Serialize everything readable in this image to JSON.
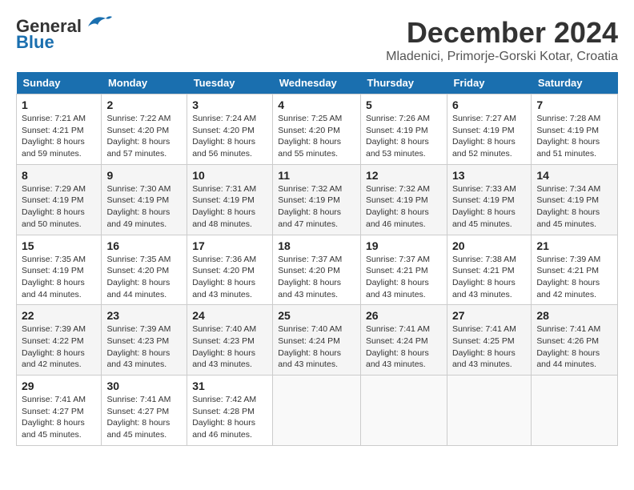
{
  "header": {
    "logo_general": "General",
    "logo_blue": "Blue",
    "month": "December 2024",
    "location": "Mladenici, Primorje-Gorski Kotar, Croatia"
  },
  "days_of_week": [
    "Sunday",
    "Monday",
    "Tuesday",
    "Wednesday",
    "Thursday",
    "Friday",
    "Saturday"
  ],
  "weeks": [
    [
      {
        "day": 1,
        "sunrise": "7:21 AM",
        "sunset": "4:21 PM",
        "daylight": "8 hours and 59 minutes."
      },
      {
        "day": 2,
        "sunrise": "7:22 AM",
        "sunset": "4:20 PM",
        "daylight": "8 hours and 57 minutes."
      },
      {
        "day": 3,
        "sunrise": "7:24 AM",
        "sunset": "4:20 PM",
        "daylight": "8 hours and 56 minutes."
      },
      {
        "day": 4,
        "sunrise": "7:25 AM",
        "sunset": "4:20 PM",
        "daylight": "8 hours and 55 minutes."
      },
      {
        "day": 5,
        "sunrise": "7:26 AM",
        "sunset": "4:19 PM",
        "daylight": "8 hours and 53 minutes."
      },
      {
        "day": 6,
        "sunrise": "7:27 AM",
        "sunset": "4:19 PM",
        "daylight": "8 hours and 52 minutes."
      },
      {
        "day": 7,
        "sunrise": "7:28 AM",
        "sunset": "4:19 PM",
        "daylight": "8 hours and 51 minutes."
      }
    ],
    [
      {
        "day": 8,
        "sunrise": "7:29 AM",
        "sunset": "4:19 PM",
        "daylight": "8 hours and 50 minutes."
      },
      {
        "day": 9,
        "sunrise": "7:30 AM",
        "sunset": "4:19 PM",
        "daylight": "8 hours and 49 minutes."
      },
      {
        "day": 10,
        "sunrise": "7:31 AM",
        "sunset": "4:19 PM",
        "daylight": "8 hours and 48 minutes."
      },
      {
        "day": 11,
        "sunrise": "7:32 AM",
        "sunset": "4:19 PM",
        "daylight": "8 hours and 47 minutes."
      },
      {
        "day": 12,
        "sunrise": "7:32 AM",
        "sunset": "4:19 PM",
        "daylight": "8 hours and 46 minutes."
      },
      {
        "day": 13,
        "sunrise": "7:33 AM",
        "sunset": "4:19 PM",
        "daylight": "8 hours and 45 minutes."
      },
      {
        "day": 14,
        "sunrise": "7:34 AM",
        "sunset": "4:19 PM",
        "daylight": "8 hours and 45 minutes."
      }
    ],
    [
      {
        "day": 15,
        "sunrise": "7:35 AM",
        "sunset": "4:19 PM",
        "daylight": "8 hours and 44 minutes."
      },
      {
        "day": 16,
        "sunrise": "7:35 AM",
        "sunset": "4:20 PM",
        "daylight": "8 hours and 44 minutes."
      },
      {
        "day": 17,
        "sunrise": "7:36 AM",
        "sunset": "4:20 PM",
        "daylight": "8 hours and 43 minutes."
      },
      {
        "day": 18,
        "sunrise": "7:37 AM",
        "sunset": "4:20 PM",
        "daylight": "8 hours and 43 minutes."
      },
      {
        "day": 19,
        "sunrise": "7:37 AM",
        "sunset": "4:21 PM",
        "daylight": "8 hours and 43 minutes."
      },
      {
        "day": 20,
        "sunrise": "7:38 AM",
        "sunset": "4:21 PM",
        "daylight": "8 hours and 43 minutes."
      },
      {
        "day": 21,
        "sunrise": "7:39 AM",
        "sunset": "4:21 PM",
        "daylight": "8 hours and 42 minutes."
      }
    ],
    [
      {
        "day": 22,
        "sunrise": "7:39 AM",
        "sunset": "4:22 PM",
        "daylight": "8 hours and 42 minutes."
      },
      {
        "day": 23,
        "sunrise": "7:39 AM",
        "sunset": "4:23 PM",
        "daylight": "8 hours and 43 minutes."
      },
      {
        "day": 24,
        "sunrise": "7:40 AM",
        "sunset": "4:23 PM",
        "daylight": "8 hours and 43 minutes."
      },
      {
        "day": 25,
        "sunrise": "7:40 AM",
        "sunset": "4:24 PM",
        "daylight": "8 hours and 43 minutes."
      },
      {
        "day": 26,
        "sunrise": "7:41 AM",
        "sunset": "4:24 PM",
        "daylight": "8 hours and 43 minutes."
      },
      {
        "day": 27,
        "sunrise": "7:41 AM",
        "sunset": "4:25 PM",
        "daylight": "8 hours and 43 minutes."
      },
      {
        "day": 28,
        "sunrise": "7:41 AM",
        "sunset": "4:26 PM",
        "daylight": "8 hours and 44 minutes."
      }
    ],
    [
      {
        "day": 29,
        "sunrise": "7:41 AM",
        "sunset": "4:27 PM",
        "daylight": "8 hours and 45 minutes."
      },
      {
        "day": 30,
        "sunrise": "7:41 AM",
        "sunset": "4:27 PM",
        "daylight": "8 hours and 45 minutes."
      },
      {
        "day": 31,
        "sunrise": "7:42 AM",
        "sunset": "4:28 PM",
        "daylight": "8 hours and 46 minutes."
      },
      null,
      null,
      null,
      null
    ]
  ]
}
